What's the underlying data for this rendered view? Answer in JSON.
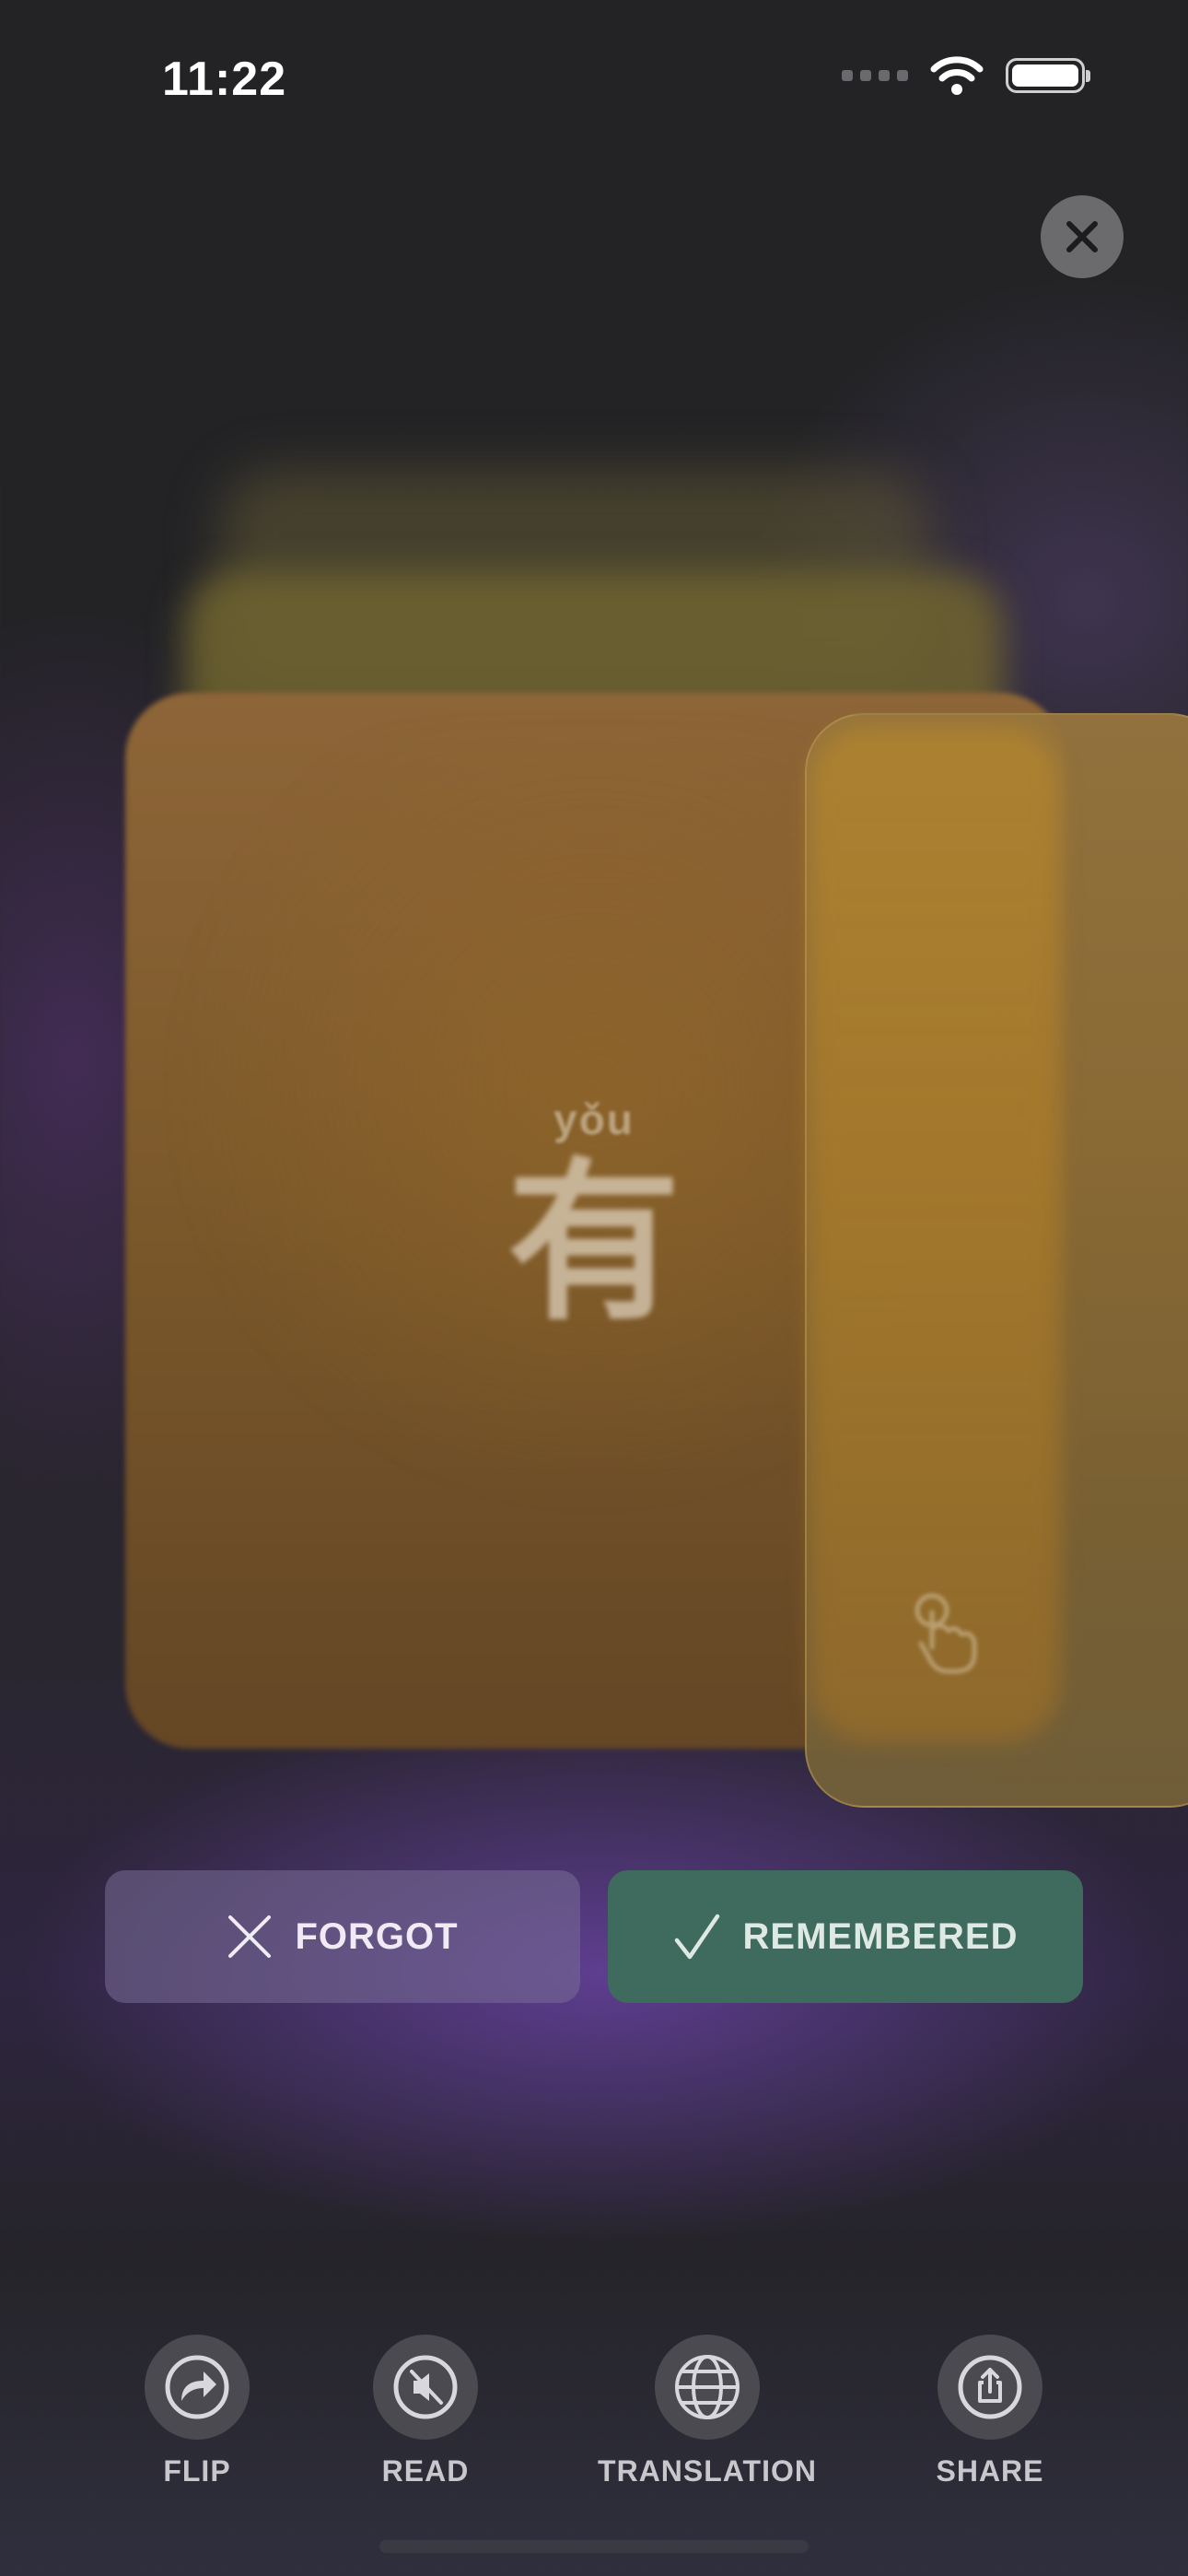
{
  "status_bar": {
    "time": "11:22"
  },
  "card": {
    "pinyin": "yǒu",
    "character": "有"
  },
  "actions": {
    "forgot_label": "FORGOT",
    "remembered_label": "REMEMBERED"
  },
  "colors": {
    "forgot": "#6e6788",
    "remembered": "#3f6b5e",
    "card": "#8d6538"
  },
  "toolbar": [
    {
      "label": "FLIP",
      "icon": "flip-arrow-icon"
    },
    {
      "label": "READ",
      "icon": "speaker-muted-icon"
    },
    {
      "label": "TRANSLATION",
      "icon": "globe-icon"
    },
    {
      "label": "SHARE",
      "icon": "share-icon"
    }
  ]
}
